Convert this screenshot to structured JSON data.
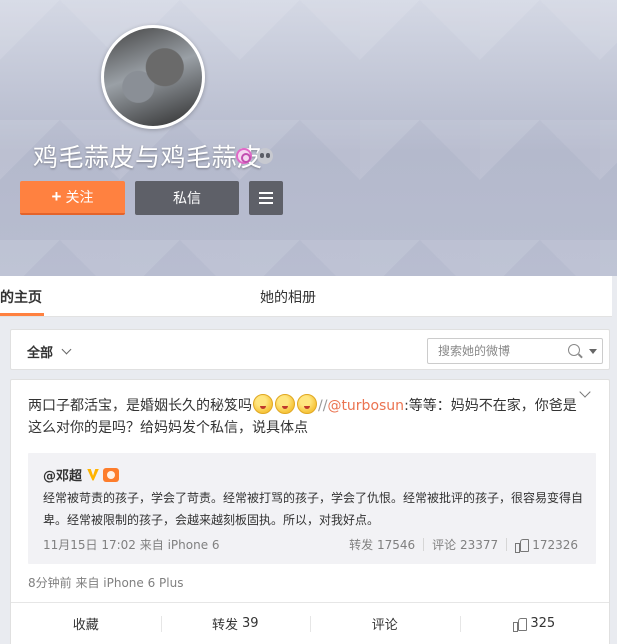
{
  "header": {
    "name": "鸡毛蒜皮与鸡毛蒜皮",
    "follow_label": "关注",
    "follow_plus": "+",
    "message_label": "私信",
    "icons": {
      "avatar": "profile-photo",
      "badge_pink": "member-level-icon",
      "badge_grey": "mascot-icon",
      "menu": "hamburger-menu-icon"
    }
  },
  "tabs": [
    {
      "label": "的主页"
    },
    {
      "label": "她的相册"
    }
  ],
  "filter": {
    "all_label": "全部",
    "search_placeholder": "搜索她的微博"
  },
  "post": {
    "text_before": "两口子都活宝，是婚姻长久的秘笈吗",
    "emoji_count": 3,
    "sep": "//",
    "mention": "@turbosun",
    "text_after": ":等等：妈妈不在家，你爸是这么对你的是吗？给妈妈发个私信，说具体点",
    "repost": {
      "author": "@邓超",
      "text": "经常被苛责的孩子，学会了苛责。经常被打骂的孩子，学会了仇恨。经常被批评的孩子，很容易变得自卑。经常被限制的孩子，会越来越刻板固执。所以，对我好点。",
      "meta": "11月15日 17:02 来自 iPhone 6",
      "repost_label": "转发",
      "repost_count": "17546",
      "comment_label": "评论",
      "comment_count": "23377",
      "like_count": "172326"
    },
    "meta": "8分钟前 来自 iPhone 6 Plus",
    "actions": {
      "collect": "收藏",
      "forward": "转发",
      "forward_count": "39",
      "comment": "评论",
      "like_count": "325"
    }
  },
  "colors": {
    "accent": "#ff8140",
    "link": "#eb7350",
    "dark_button": "#5e6068"
  }
}
